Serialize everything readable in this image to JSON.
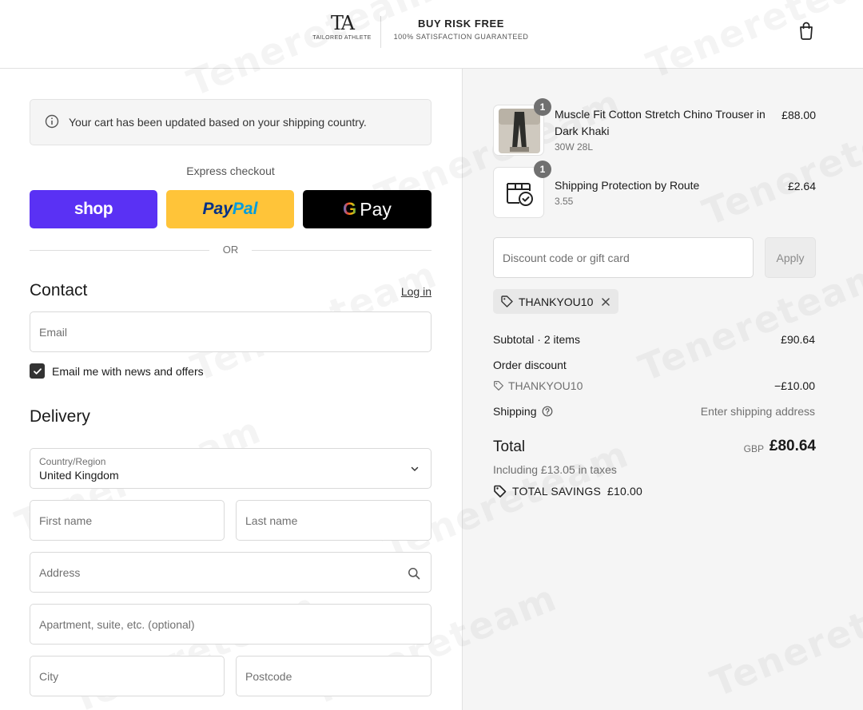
{
  "header": {
    "brand_mark": "TA",
    "brand_name": "TAILORED ATHLETE",
    "promo_title": "BUY RISK FREE",
    "promo_subtitle": "100% SATISFACTION GUARANTEED",
    "cart_icon": "shopping-bag-icon"
  },
  "notice": {
    "icon": "info-icon",
    "text": "Your cart has been updated based on your shipping country."
  },
  "express": {
    "label": "Express checkout",
    "shop_label": "shop",
    "paypal_pay": "Pay",
    "paypal_pal": "Pal",
    "gpay_g": "G",
    "gpay_label": "Pay",
    "or_label": "OR",
    "colors": {
      "shop": "#5a31f4",
      "paypal": "#ffc439",
      "gpay": "#000000"
    }
  },
  "contact": {
    "title": "Contact",
    "login_label": "Log in",
    "email_placeholder": "Email",
    "newsletter_label": "Email me with news and offers",
    "newsletter_checked": true
  },
  "delivery": {
    "title": "Delivery",
    "country_label": "Country/Region",
    "country_value": "United Kingdom",
    "first_name_placeholder": "First name",
    "last_name_placeholder": "Last name",
    "address_placeholder": "Address",
    "apartment_placeholder": "Apartment, suite, etc. (optional)",
    "city_placeholder": "City",
    "postcode_placeholder": "Postcode"
  },
  "summary": {
    "items": [
      {
        "name": "Muscle Fit Cotton Stretch Chino Trouser in Dark Khaki",
        "variant": "30W 28L",
        "price": "£88.00",
        "qty": "1"
      },
      {
        "name": "Shipping Protection by Route",
        "variant": "3.55",
        "price": "£2.64",
        "qty": "1"
      }
    ],
    "discount_placeholder": "Discount code or gift card",
    "apply_label": "Apply",
    "applied_code": "THANKYOU10",
    "subtotal_label": "Subtotal · 2 items",
    "subtotal_value": "£90.64",
    "order_discount_label": "Order discount",
    "discount_code": "THANKYOU10",
    "discount_value": "−£10.00",
    "shipping_label": "Shipping",
    "shipping_value": "Enter shipping address",
    "total_label": "Total",
    "total_currency": "GBP",
    "total_value": "£80.64",
    "tax_line": "Including £13.05 in taxes",
    "savings_label": "TOTAL SAVINGS",
    "savings_value": "£10.00"
  },
  "watermark": "Tenereteam"
}
